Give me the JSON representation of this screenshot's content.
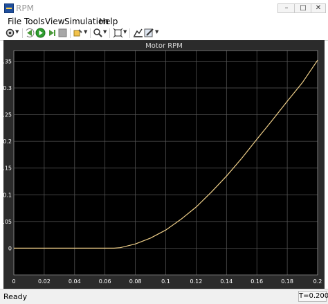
{
  "window": {
    "title": "RPM"
  },
  "menu": {
    "items": [
      "File",
      "Tools",
      "View",
      "Simulation",
      "Help"
    ]
  },
  "toolbar": {
    "buttons": [
      "settings-icon",
      "step-back-icon",
      "run-icon",
      "step-forward-icon",
      "stop-icon",
      "highlight-icon",
      "zoom-icon",
      "fit-icon",
      "cursor-measure-icon",
      "style-icon"
    ]
  },
  "chart_data": {
    "type": "line",
    "title": "Motor RPM",
    "xlabel": "",
    "ylabel": "",
    "xlim": [
      0,
      0.2
    ],
    "ylim": [
      -0.05,
      0.37
    ],
    "x_ticks": [
      "0",
      "0.02",
      "0.04",
      "0.06",
      "0.08",
      "0.1",
      "0.12",
      "0.14",
      "0.16",
      "0.18",
      "0.2"
    ],
    "y_ticks": [
      "0",
      "0.05",
      "0.1",
      "0.15",
      "0.2",
      "0.25",
      "0.3",
      "0.35"
    ],
    "grid": true,
    "colors": {
      "background": "#000000",
      "frame": "#2b2b2b",
      "axis_text": "#ffffff",
      "grid": "#5a5a5a",
      "line": "#f0d08a"
    },
    "series": [
      {
        "x": [
          0,
          0.02,
          0.04,
          0.06,
          0.066,
          0.07,
          0.08,
          0.09,
          0.1,
          0.11,
          0.12,
          0.13,
          0.14,
          0.15,
          0.16,
          0.17,
          0.18,
          0.19,
          0.2
        ],
        "values": [
          0,
          0,
          0,
          0,
          0,
          0.001,
          0.008,
          0.019,
          0.034,
          0.054,
          0.077,
          0.105,
          0.135,
          0.168,
          0.204,
          0.239,
          0.275,
          0.31,
          0.352
        ]
      }
    ]
  },
  "status": {
    "left": "Ready",
    "right": "T=0.200"
  }
}
